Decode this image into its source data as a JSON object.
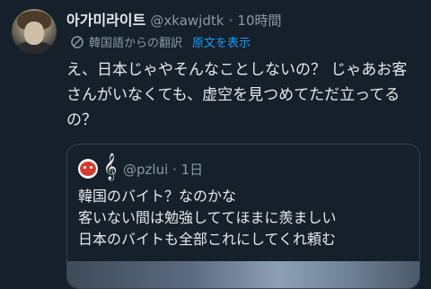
{
  "tweet": {
    "display_name": "아가미라이트",
    "handle": "@xkawjdtk",
    "separator": "·",
    "time": "10時間",
    "translation_note": "韓国語からの翻訳",
    "show_original": "原文を表示",
    "text": "え、日本じゃやそんなことしないの？ じゃあお客さんがいなくても、虚空を見つめてただ立ってるの？"
  },
  "quoted": {
    "handle": "@pzlui",
    "separator": "·",
    "time": "1日",
    "lines": [
      "韓国のバイト？なのかな",
      "客いない間は勉強しててほまに羨ましい",
      "日本のバイトも全部これにしてくれ頼む"
    ]
  },
  "colors": {
    "background": "#15202b",
    "text": "#e7e9ea",
    "muted": "#8b98a5",
    "link": "#1d9bf0",
    "border": "#38444d"
  },
  "icons": {
    "translate": "translate-icon",
    "clef": "treble-clef-icon"
  }
}
